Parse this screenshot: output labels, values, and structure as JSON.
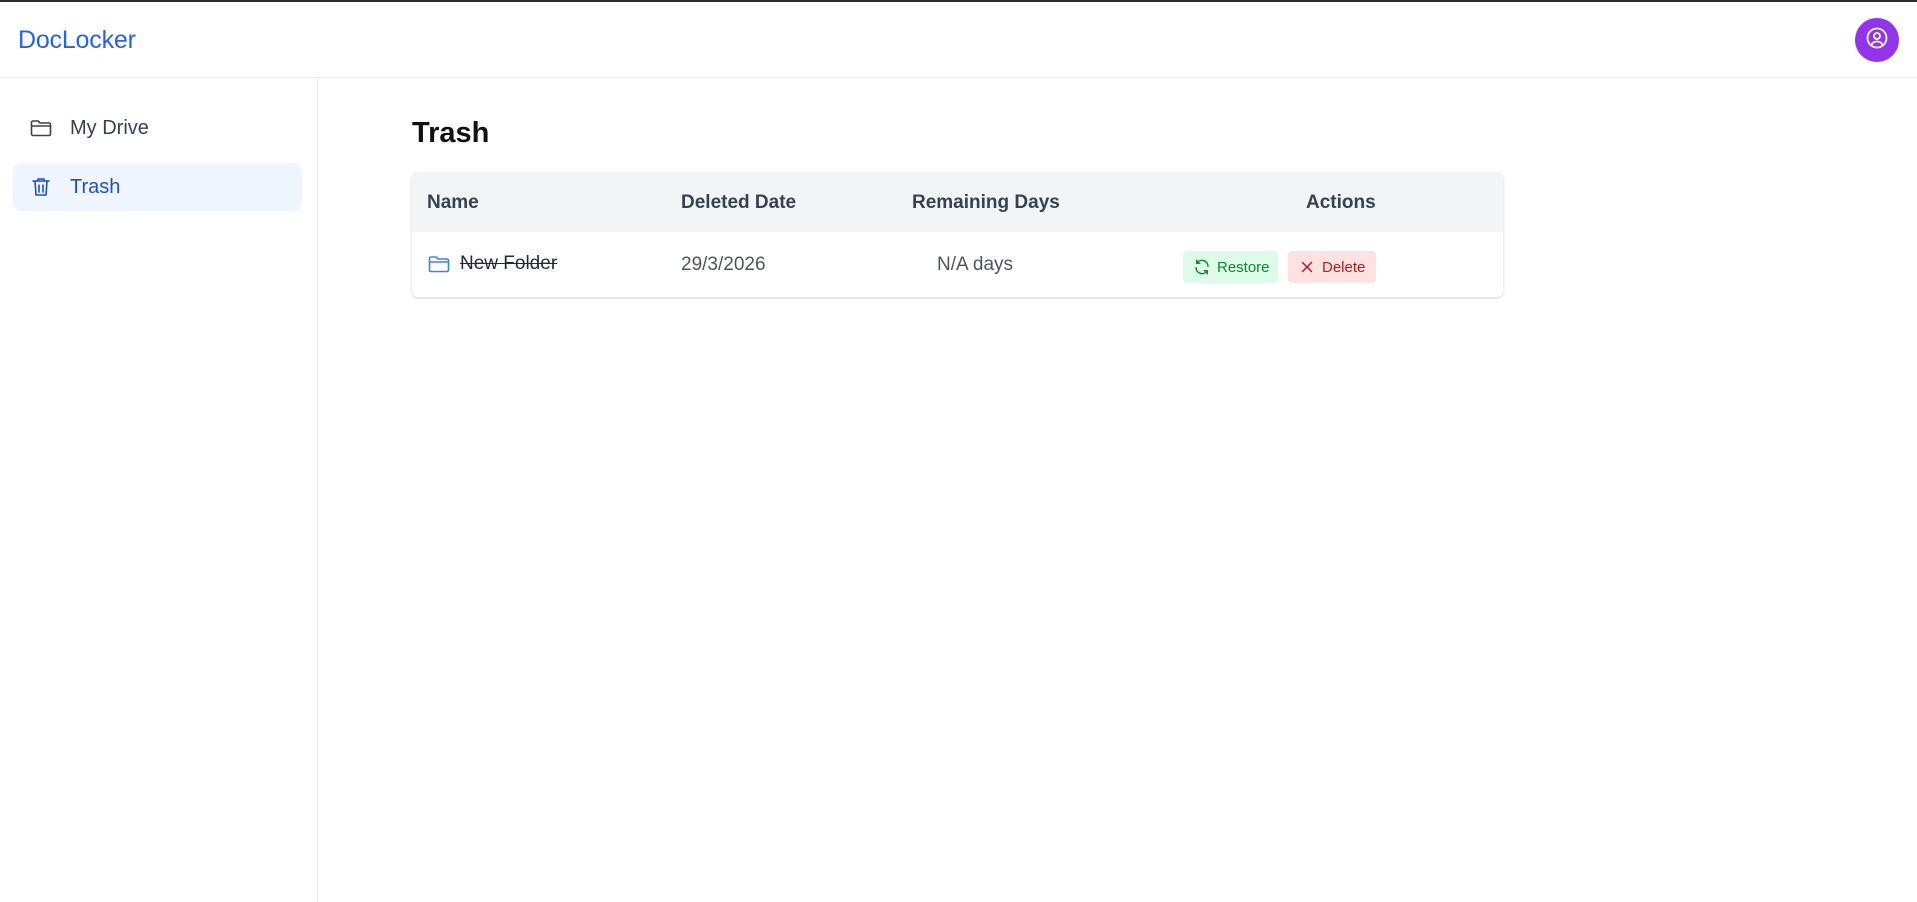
{
  "app": {
    "brand": "DocLocker"
  },
  "sidebar": {
    "items": [
      {
        "label": "My Drive",
        "icon": "folder-icon",
        "active": false
      },
      {
        "label": "Trash",
        "icon": "trash-icon",
        "active": true
      }
    ]
  },
  "main": {
    "title": "Trash",
    "table": {
      "headers": {
        "name": "Name",
        "deleted_date": "Deleted Date",
        "remaining_days": "Remaining Days",
        "actions": "Actions"
      },
      "rows": [
        {
          "name": "New Folder",
          "type_icon": "folder-icon",
          "deleted_date": "29/3/2026",
          "remaining_days": "N/A days",
          "restore_label": "Restore",
          "delete_label": "Delete"
        }
      ]
    }
  },
  "colors": {
    "brand": "#2563eb",
    "avatar": "#9333ea",
    "active_nav_bg": "#eff6ff",
    "restore_bg": "#dcfce7",
    "restore_text": "#15803d",
    "delete_bg": "#fee2e2",
    "delete_text": "#b91c1c"
  }
}
